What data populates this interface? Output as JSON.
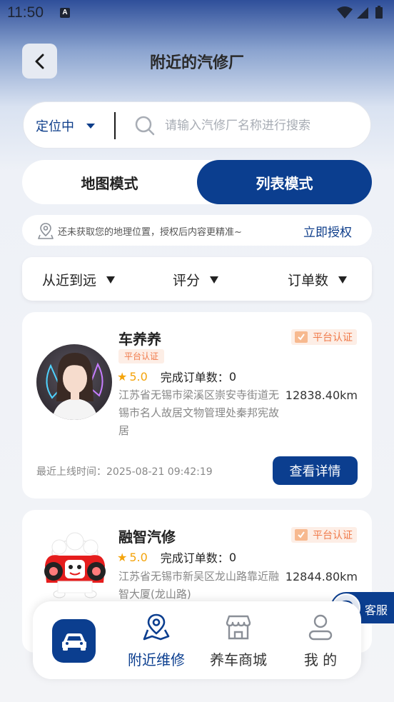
{
  "status_bar": {
    "time": "11:50",
    "notification": "A"
  },
  "header": {
    "title": "附近的汽修厂",
    "back_icon": "chevron-left-icon"
  },
  "search": {
    "location_label": "定位中",
    "placeholder": "请输入汽修厂名称进行搜索",
    "value": ""
  },
  "mode_toggle": {
    "map_label": "地图模式",
    "list_label": "列表模式",
    "active": "list"
  },
  "location_notice": {
    "text": "还未获取您的地理位置，授权后内容更精准~",
    "action_label": "立即授权"
  },
  "sort_bar": {
    "items": [
      {
        "label": "从近到远"
      },
      {
        "label": "评分"
      },
      {
        "label": "订单数"
      }
    ]
  },
  "shops": [
    {
      "name": "车养养",
      "cert_badge": "平台认证",
      "cert_tag": "平台认证",
      "rating": "5.0",
      "orders_label": "完成订单数：",
      "orders": "0",
      "address": "江苏省无锡市梁溪区崇安寺街道无锡市名人故居文物管理处秦邦宪故居",
      "distance": "12838.40km",
      "last_online": "最近上线时间：2025-08-21 09:42:19",
      "detail_label": "查看详情"
    },
    {
      "name": "融智汽修",
      "cert_badge": "平台认证",
      "rating": "5.0",
      "orders_label": "完成订单数：",
      "orders": "0",
      "address": "江苏省无锡市新吴区龙山路靠近融智大厦(龙山路)",
      "distance": "12844.80km"
    }
  ],
  "customer_service": {
    "label": "客服"
  },
  "bottom_nav": {
    "items": [
      {
        "label": "附近维修",
        "icon": "map-pin-icon",
        "active": true
      },
      {
        "label": "养车商城",
        "icon": "store-icon",
        "active": false
      },
      {
        "label": "我 的",
        "icon": "user-icon",
        "active": false
      }
    ],
    "home_icon": "car-icon"
  },
  "colors": {
    "primary": "#0b3e8f",
    "rating": "#f4a40c",
    "cert": "#f07a4a"
  }
}
